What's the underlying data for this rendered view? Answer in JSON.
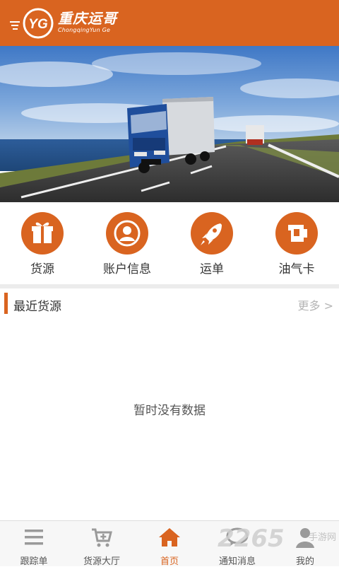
{
  "header": {
    "logo_cn": "重庆运哥",
    "logo_en": "ChongqingYun Ge",
    "brand_color": "#d96420"
  },
  "banner": {
    "icon": "truck-highway-photo"
  },
  "menu": [
    {
      "label": "货源",
      "icon": "gift-icon"
    },
    {
      "label": "账户信息",
      "icon": "user-icon"
    },
    {
      "label": "运单",
      "icon": "rocket-icon"
    },
    {
      "label": "油气卡",
      "icon": "fuel-card-icon"
    }
  ],
  "section": {
    "title": "最近货源",
    "more": "更多 >"
  },
  "empty_text": "暂时没有数据",
  "nav": [
    {
      "label": "跟踪单",
      "icon": "list-icon"
    },
    {
      "label": "货源大厅",
      "icon": "cart-add-icon"
    },
    {
      "label": "首页",
      "icon": "home-icon",
      "active": true
    },
    {
      "label": "通知消息",
      "icon": "chat-icon"
    },
    {
      "label": "我的",
      "icon": "person-icon"
    }
  ],
  "watermark": {
    "number": "2265",
    "text": "手游网"
  }
}
